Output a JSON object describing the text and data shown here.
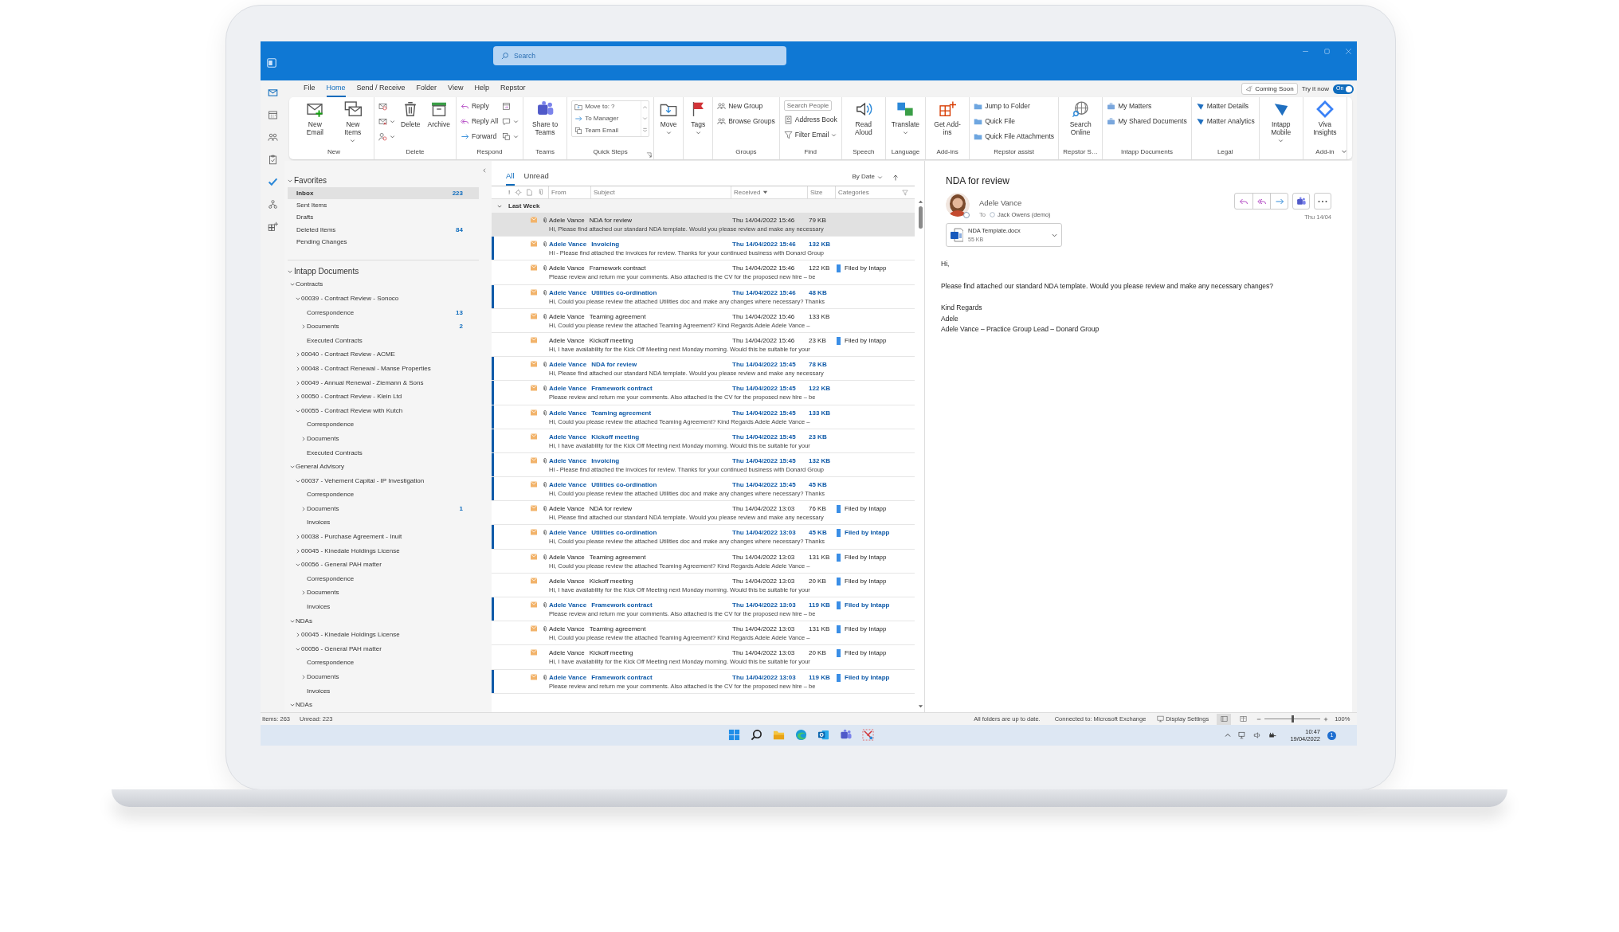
{
  "window": {
    "search_placeholder": "Search"
  },
  "menu_tabs": [
    {
      "label": "File",
      "selected": false
    },
    {
      "label": "Home",
      "selected": true
    },
    {
      "label": "Send / Receive",
      "selected": false
    },
    {
      "label": "Folder",
      "selected": false
    },
    {
      "label": "View",
      "selected": false
    },
    {
      "label": "Help",
      "selected": false
    },
    {
      "label": "Repstor",
      "selected": false
    }
  ],
  "preview_bar": {
    "coming_soon": "Coming Soon",
    "try_label": "Try it now",
    "toggle_label": "On",
    "on": true
  },
  "ribbon": {
    "groups": [
      {
        "label": "New",
        "items": [
          {
            "kind": "large",
            "label": "New Email",
            "menu": false
          },
          {
            "kind": "large",
            "label": "New Items",
            "menu": true
          }
        ]
      },
      {
        "label": "Delete",
        "items": [
          {
            "kind": "icon",
            "menu": false
          },
          {
            "kind": "icon",
            "menu": true
          },
          {
            "kind": "icon",
            "menu": true
          },
          {
            "kind": "large",
            "label": "Delete",
            "menu": false
          },
          {
            "kind": "large",
            "label": "Archive",
            "menu": false
          }
        ]
      },
      {
        "label": "Respond",
        "items": [
          {
            "kind": "small",
            "label": "Reply",
            "menu": false
          },
          {
            "kind": "small",
            "label": "Reply All",
            "menu": false
          },
          {
            "kind": "small",
            "label": "Forward",
            "menu": false
          },
          {
            "kind": "icon",
            "menu": false
          },
          {
            "kind": "icon",
            "menu": true
          },
          {
            "kind": "icon",
            "menu": true
          }
        ]
      },
      {
        "label": "Teams",
        "items": [
          {
            "kind": "large",
            "label": "Share to Teams",
            "menu": false
          }
        ]
      },
      {
        "label": "Quick Steps",
        "launcher": true,
        "items": [
          {
            "kind": "gallery",
            "entries": [
              "Move to: ?",
              "To Manager",
              "Team Email"
            ]
          }
        ]
      },
      {
        "items": [
          {
            "kind": "large",
            "label": "Move",
            "menu": true
          }
        ]
      },
      {
        "items": [
          {
            "kind": "large",
            "label": "Tags",
            "menu": true
          }
        ]
      },
      {
        "label": "Groups",
        "items": [
          {
            "kind": "small",
            "label": "New Group",
            "menu": false
          },
          {
            "kind": "small",
            "label": "Browse Groups",
            "menu": false
          }
        ]
      },
      {
        "label": "Find",
        "items": [
          {
            "kind": "field",
            "placeholder": "Search People"
          },
          {
            "kind": "small",
            "label": "Address Book",
            "menu": false
          },
          {
            "kind": "small",
            "label": "Filter Email",
            "menu": true
          }
        ]
      },
      {
        "label": "Speech",
        "items": [
          {
            "kind": "large",
            "label": "Read Aloud",
            "menu": false
          }
        ]
      },
      {
        "label": "Language",
        "items": [
          {
            "kind": "large",
            "label": "Translate",
            "menu": true
          }
        ]
      },
      {
        "label": "Add-ins",
        "items": [
          {
            "kind": "large",
            "label": "Get Add-ins",
            "menu": false
          }
        ]
      },
      {
        "label": "Repstor assist",
        "items": [
          {
            "kind": "small",
            "label": "Jump to Folder",
            "menu": false
          },
          {
            "kind": "small",
            "label": "Quick File",
            "menu": false
          },
          {
            "kind": "small",
            "label": "Quick File Attachments",
            "menu": false
          }
        ]
      },
      {
        "label": "Repstor S…",
        "items": [
          {
            "kind": "large",
            "label": "Search Online",
            "menu": false
          }
        ]
      },
      {
        "label": "Intapp Documents",
        "items": [
          {
            "kind": "small",
            "label": "My Matters",
            "menu": false
          },
          {
            "kind": "small",
            "label": "My Shared Documents",
            "menu": false
          }
        ]
      },
      {
        "label": "Legal",
        "items": [
          {
            "kind": "small",
            "label": "Matter Details",
            "menu": false
          },
          {
            "kind": "small",
            "label": "Matter Analytics",
            "menu": false
          }
        ]
      },
      {
        "items": [
          {
            "kind": "large",
            "label": "Intapp Mobile",
            "menu": true
          }
        ]
      },
      {
        "label": "Add-in",
        "items": [
          {
            "kind": "large",
            "label": "Viva Insights",
            "menu": false
          }
        ]
      }
    ]
  },
  "folder_pane": {
    "favorites": {
      "label": "Favorites",
      "expanded": true,
      "items": [
        {
          "label": "Inbox",
          "count": "223",
          "selected": true
        },
        {
          "label": "Sent Items",
          "selected": false
        },
        {
          "label": "Drafts",
          "selected": false
        },
        {
          "label": "Deleted Items",
          "count": "84",
          "selected": false
        },
        {
          "label": "Pending Changes",
          "selected": false
        }
      ]
    },
    "tree": {
      "label": "Intapp Documents",
      "expanded": true,
      "children": [
        {
          "label": "Contracts",
          "expanded": true,
          "children": [
            {
              "label": "00039 - Contract Review - Sonoco",
              "expanded": true,
              "children": [
                {
                  "label": "Correspondence",
                  "count": "13"
                },
                {
                  "label": "Documents",
                  "count": "2",
                  "expanded": false
                },
                {
                  "label": "Executed Contracts"
                }
              ]
            },
            {
              "label": "00040 - Contract Review - ACME",
              "expanded": false
            },
            {
              "label": "00048 - Contract Renewal - Manse Properties",
              "expanded": false
            },
            {
              "label": "00049 - Annual Renewal - Ziemann & Sons",
              "expanded": false
            },
            {
              "label": "00050 - Contract Review - Klein Ltd",
              "expanded": false
            },
            {
              "label": "00055 - Contract Review with Kutch",
              "expanded": true,
              "children": [
                {
                  "label": "Correspondence"
                },
                {
                  "label": "Documents",
                  "expanded": false
                },
                {
                  "label": "Executed Contracts"
                }
              ]
            }
          ]
        },
        {
          "label": "General Advisory",
          "expanded": true,
          "children": [
            {
              "label": "00037 - Vehement Capital - IP Investigation",
              "expanded": true,
              "children": [
                {
                  "label": "Correspondence"
                },
                {
                  "label": "Documents",
                  "count": "1",
                  "expanded": false
                },
                {
                  "label": "Invoices"
                }
              ]
            },
            {
              "label": "00038 - Purchase Agreement - Inuit",
              "expanded": false
            },
            {
              "label": "00045 - Kinedale Holdings License",
              "expanded": false
            },
            {
              "label": "00056 - General PAH matter",
              "expanded": true,
              "children": [
                {
                  "label": "Correspondence"
                },
                {
                  "label": "Documents",
                  "expanded": false
                },
                {
                  "label": "Invoices"
                }
              ]
            }
          ]
        },
        {
          "label": "NDAs",
          "expanded": true,
          "children": [
            {
              "label": "00045 - Kinedale Holdings License",
              "expanded": false
            },
            {
              "label": "00056 - General PAH matter",
              "expanded": true,
              "children": [
                {
                  "label": "Correspondence"
                },
                {
                  "label": "Documents",
                  "expanded": false
                },
                {
                  "label": "Invoices"
                }
              ]
            }
          ]
        },
        {
          "label": "NDAs",
          "expanded": true
        }
      ]
    }
  },
  "message_list": {
    "tabs": [
      {
        "label": "All",
        "selected": true
      },
      {
        "label": "Unread",
        "selected": false
      }
    ],
    "sort": "By Date",
    "importance_mark": "!",
    "columns": [
      "From",
      "Subject",
      "Received",
      "Size",
      "Categories"
    ],
    "group": {
      "label": "Last Week",
      "expanded": true
    },
    "rows": [
      {
        "from": "Adele Vance",
        "subject": "NDA for review",
        "preview": "Hi, Please find attached our standard NDA template. Would you please review and make any necessary",
        "received": "Thu 14/04/2022 15:46",
        "size": "79 KB",
        "unread": false,
        "attachment": true,
        "selected": true
      },
      {
        "from": "Adele Vance",
        "subject": "Invoicing",
        "preview": "Hi - Please find attached the invoices for review. Thanks for your continued business with Donard Group",
        "received": "Thu 14/04/2022 15:46",
        "size": "132 KB",
        "unread": true,
        "attachment": true,
        "selected": false
      },
      {
        "from": "Adele Vance",
        "subject": "Framework contract",
        "preview": "Please review and return me your comments. Also attached is the CV for the proposed new hire – be",
        "received": "Thu 14/04/2022 15:46",
        "size": "122 KB",
        "category": "Filed by Intapp",
        "unread": false,
        "attachment": true,
        "selected": false
      },
      {
        "from": "Adele Vance",
        "subject": "Utilities co-ordination",
        "preview": "Hi, Could you please review the attached Utilities doc and make any changes where necessary? Thanks",
        "received": "Thu 14/04/2022 15:46",
        "size": "48 KB",
        "unread": true,
        "attachment": true,
        "selected": false
      },
      {
        "from": "Adele Vance",
        "subject": "Teaming agreement",
        "preview": "Hi, Could you please review the attached Teaming Agreement? Kind Regards Adele Adele Vance –",
        "received": "Thu 14/04/2022 15:46",
        "size": "133 KB",
        "unread": false,
        "attachment": true,
        "selected": false
      },
      {
        "from": "Adele Vance",
        "subject": "Kickoff meeting",
        "preview": "Hi, I have availability for the Kick Off Meeting next Monday morning. Would this be suitable for your",
        "received": "Thu 14/04/2022 15:46",
        "size": "23 KB",
        "category": "Filed by Intapp",
        "unread": false,
        "attachment": false,
        "selected": false
      },
      {
        "from": "Adele Vance",
        "subject": "NDA for review",
        "preview": "Hi, Please find attached our standard NDA template. Would you please review and make any necessary",
        "received": "Thu 14/04/2022 15:45",
        "size": "78 KB",
        "unread": true,
        "attachment": true,
        "selected": false
      },
      {
        "from": "Adele Vance",
        "subject": "Framework contract",
        "preview": "Please review and return me your comments. Also attached is the CV for the proposed new hire – be",
        "received": "Thu 14/04/2022 15:45",
        "size": "122 KB",
        "unread": true,
        "attachment": true,
        "selected": false
      },
      {
        "from": "Adele Vance",
        "subject": "Teaming agreement",
        "preview": "Hi, Could you please review the attached Teaming Agreement? Kind Regards Adele Adele Vance –",
        "received": "Thu 14/04/2022 15:45",
        "size": "133 KB",
        "unread": true,
        "attachment": true,
        "selected": false
      },
      {
        "from": "Adele Vance",
        "subject": "Kickoff meeting",
        "preview": "Hi, I have availability for the Kick Off Meeting next Monday morning. Would this be suitable for your",
        "received": "Thu 14/04/2022 15:45",
        "size": "23 KB",
        "unread": true,
        "attachment": false,
        "selected": false
      },
      {
        "from": "Adele Vance",
        "subject": "Invoicing",
        "preview": "Hi - Please find attached the invoices for review. Thanks for your continued business with Donard Group",
        "received": "Thu 14/04/2022 15:45",
        "size": "132 KB",
        "unread": true,
        "attachment": true,
        "selected": false
      },
      {
        "from": "Adele Vance",
        "subject": "Utilities co-ordination",
        "preview": "Hi, Could you please review the attached Utilities doc and make any changes where necessary? Thanks",
        "received": "Thu 14/04/2022 15:45",
        "size": "45 KB",
        "unread": true,
        "attachment": true,
        "selected": false
      },
      {
        "from": "Adele Vance",
        "subject": "NDA for review",
        "preview": "Hi, Please find attached our standard NDA template. Would you please review and make any necessary",
        "received": "Thu 14/04/2022 13:03",
        "size": "76 KB",
        "category": "Filed by Intapp",
        "unread": false,
        "attachment": true,
        "selected": false
      },
      {
        "from": "Adele Vance",
        "subject": "Utilities co-ordination",
        "preview": "Hi, Could you please review the attached Utilities doc and make any changes where necessary? Thanks",
        "received": "Thu 14/04/2022 13:03",
        "size": "45 KB",
        "category": "Filed by Intapp",
        "unread": true,
        "attachment": true,
        "selected": false
      },
      {
        "from": "Adele Vance",
        "subject": "Teaming agreement",
        "preview": "Hi, Could you please review the attached Teaming Agreement? Kind Regards Adele Adele Vance –",
        "received": "Thu 14/04/2022 13:03",
        "size": "131 KB",
        "category": "Filed by Intapp",
        "unread": false,
        "attachment": true,
        "selected": false
      },
      {
        "from": "Adele Vance",
        "subject": "Kickoff meeting",
        "preview": "Hi, I have availability for the Kick Off Meeting next Monday morning. Would this be suitable for your",
        "received": "Thu 14/04/2022 13:03",
        "size": "20 KB",
        "category": "Filed by Intapp",
        "unread": false,
        "attachment": false,
        "selected": false
      },
      {
        "from": "Adele Vance",
        "subject": "Framework contract",
        "preview": "Please review and return me your comments. Also attached is the CV for the proposed new hire – be",
        "received": "Thu 14/04/2022 13:03",
        "size": "119 KB",
        "category": "Filed by Intapp",
        "unread": true,
        "attachment": true,
        "selected": false
      },
      {
        "from": "Adele Vance",
        "subject": "Teaming agreement",
        "preview": "Hi, Could you please review the attached Teaming Agreement? Kind Regards Adele Adele Vance –",
        "received": "Thu 14/04/2022 13:03",
        "size": "131 KB",
        "category": "Filed by Intapp",
        "unread": false,
        "attachment": true,
        "selected": false
      },
      {
        "from": "Adele Vance",
        "subject": "Kickoff meeting",
        "preview": "Hi, I have availability for the Kick Off Meeting next Monday morning. Would this be suitable for your",
        "received": "Thu 14/04/2022 13:03",
        "size": "20 KB",
        "category": "Filed by Intapp",
        "unread": false,
        "attachment": false,
        "selected": false
      },
      {
        "from": "Adele Vance",
        "subject": "Framework contract",
        "preview": "Please review and return me your comments. Also attached is the CV for the proposed new hire – be",
        "received": "Thu 14/04/2022 13:03",
        "size": "119 KB",
        "category": "Filed by Intapp",
        "unread": true,
        "attachment": true,
        "selected": false
      }
    ]
  },
  "reading_pane": {
    "subject": "NDA for review",
    "sender": "Adele Vance",
    "to_label": "To",
    "recipient": "Jack Owens (demo)",
    "date": "Thu 14/04",
    "attachment": {
      "name": "NDA Template.docx",
      "size": "55 KB"
    },
    "body": [
      "Hi,",
      "Please find attached our standard NDA template. Would you please review and make any necessary changes?",
      "Kind Regards",
      "Adele",
      "Adele Vance – Practice Group Lead – Donard Group"
    ]
  },
  "status_bar": {
    "items": "Items: 263",
    "unread": "Unread: 223",
    "sync": "All folders are up to date.",
    "connection": "Connected to: Microsoft Exchange",
    "display_settings": "Display Settings",
    "zoom": {
      "level": 0.5,
      "reading": "100%"
    }
  },
  "taskbar": {
    "time": "10:47",
    "date": "19/04/2022",
    "badge": "1"
  }
}
